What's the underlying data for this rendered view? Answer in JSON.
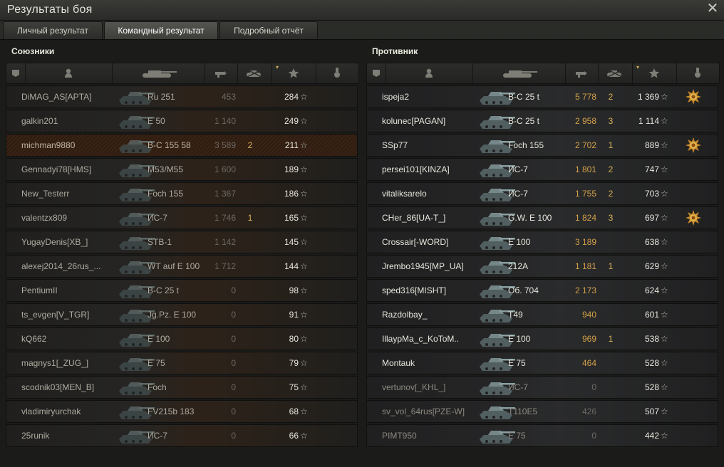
{
  "window": {
    "title": "Результаты боя"
  },
  "tabs": [
    {
      "label": "Личный результат",
      "active": false
    },
    {
      "label": "Командный результат",
      "active": true
    },
    {
      "label": "Подробный отчёт",
      "active": false
    }
  ],
  "allies": {
    "title": "Союзники",
    "rows": [
      {
        "player": "DiMAG_AS[APTA]",
        "tank": "Ru 251",
        "damage": "453",
        "kills": "",
        "xp": "284",
        "medal": false,
        "alive": false,
        "highlight": false
      },
      {
        "player": "galkin201",
        "tank": "E 50",
        "damage": "1 140",
        "kills": "",
        "xp": "249",
        "medal": false,
        "alive": false,
        "highlight": false
      },
      {
        "player": "michman9880",
        "tank": "B-C 155 58",
        "damage": "3 589",
        "kills": "2",
        "xp": "211",
        "medal": false,
        "alive": false,
        "highlight": true
      },
      {
        "player": "Gennadyi78[HMS]",
        "tank": "M53/M55",
        "damage": "1 600",
        "kills": "",
        "xp": "189",
        "medal": false,
        "alive": false,
        "highlight": false
      },
      {
        "player": "New_Testerr",
        "tank": "Foch 155",
        "damage": "1 367",
        "kills": "",
        "xp": "186",
        "medal": false,
        "alive": false,
        "highlight": false
      },
      {
        "player": "valentzx809",
        "tank": "ИС-7",
        "damage": "1 746",
        "kills": "1",
        "xp": "165",
        "medal": false,
        "alive": false,
        "highlight": false
      },
      {
        "player": "YugayDenis[XB_]",
        "tank": "STB-1",
        "damage": "1 142",
        "kills": "",
        "xp": "145",
        "medal": false,
        "alive": false,
        "highlight": false
      },
      {
        "player": "alexej2014_26rus_...",
        "tank": "WT auf E 100",
        "damage": "1 712",
        "kills": "",
        "xp": "144",
        "medal": false,
        "alive": false,
        "highlight": false
      },
      {
        "player": "PentiumII",
        "tank": "B-C 25 t",
        "damage": "0",
        "kills": "",
        "xp": "98",
        "medal": false,
        "alive": false,
        "highlight": false
      },
      {
        "player": "ts_evgen[V_TGR]",
        "tank": "Jg.Pz. E 100",
        "damage": "0",
        "kills": "",
        "xp": "91",
        "medal": false,
        "alive": false,
        "highlight": false
      },
      {
        "player": "kQ662",
        "tank": "E 100",
        "damage": "0",
        "kills": "",
        "xp": "80",
        "medal": false,
        "alive": false,
        "highlight": false
      },
      {
        "player": "magnys1[_ZUG_]",
        "tank": "E 75",
        "damage": "0",
        "kills": "",
        "xp": "79",
        "medal": false,
        "alive": false,
        "highlight": false
      },
      {
        "player": "scodnik03[MEN_B]",
        "tank": "Foch",
        "damage": "0",
        "kills": "",
        "xp": "75",
        "medal": false,
        "alive": false,
        "highlight": false
      },
      {
        "player": "vladimiryurchak",
        "tank": "FV215b 183",
        "damage": "0",
        "kills": "",
        "xp": "68",
        "medal": false,
        "alive": false,
        "highlight": false
      },
      {
        "player": "25runik",
        "tank": "ИС-7",
        "damage": "0",
        "kills": "",
        "xp": "66",
        "medal": false,
        "alive": false,
        "highlight": false
      }
    ]
  },
  "enemies": {
    "title": "Противник",
    "rows": [
      {
        "player": "ispeja2",
        "tank": "B-C 25 t",
        "damage": "5 778",
        "kills": "2",
        "xp": "1 369",
        "medal": true,
        "alive": true
      },
      {
        "player": "kolunec[PAGAN]",
        "tank": "B-C 25 t",
        "damage": "2 958",
        "kills": "3",
        "xp": "1 114",
        "medal": false,
        "alive": true
      },
      {
        "player": "SSp77",
        "tank": "Foch 155",
        "damage": "2 702",
        "kills": "1",
        "xp": "889",
        "medal": true,
        "alive": true
      },
      {
        "player": "persei101[KINZA]",
        "tank": "ИС-7",
        "damage": "1 801",
        "kills": "2",
        "xp": "747",
        "medal": false,
        "alive": true
      },
      {
        "player": "vitaliksarelo",
        "tank": "ИС-7",
        "damage": "1 755",
        "kills": "2",
        "xp": "703",
        "medal": false,
        "alive": true
      },
      {
        "player": "CHer_86[UA-T_]",
        "tank": "G.W. E 100",
        "damage": "1 824",
        "kills": "3",
        "xp": "697",
        "medal": true,
        "alive": true
      },
      {
        "player": "Crossair[-WORD]",
        "tank": "E 100",
        "damage": "3 189",
        "kills": "",
        "xp": "638",
        "medal": false,
        "alive": true
      },
      {
        "player": "Jrembo1945[MP_UA]",
        "tank": "212A",
        "damage": "1 181",
        "kills": "1",
        "xp": "629",
        "medal": false,
        "alive": true
      },
      {
        "player": "sped316[MISHT]",
        "tank": "Об. 704",
        "damage": "2 173",
        "kills": "",
        "xp": "624",
        "medal": false,
        "alive": true
      },
      {
        "player": "Razdolbay_",
        "tank": "T49",
        "damage": "940",
        "kills": "",
        "xp": "601",
        "medal": false,
        "alive": true
      },
      {
        "player": "IllaypMa_c_KoToM..",
        "tank": "E 100",
        "damage": "969",
        "kills": "1",
        "xp": "538",
        "medal": false,
        "alive": true
      },
      {
        "player": "Montauk",
        "tank": "E 75",
        "damage": "464",
        "kills": "",
        "xp": "528",
        "medal": false,
        "alive": true
      },
      {
        "player": "vertunov[_KHL_]",
        "tank": "ИС-7",
        "damage": "0",
        "kills": "",
        "xp": "528",
        "medal": false,
        "alive": false
      },
      {
        "player": "sv_vol_64rus[PZE-W]",
        "tank": "T110E5",
        "damage": "426",
        "kills": "",
        "xp": "507",
        "medal": false,
        "alive": false
      },
      {
        "player": "PIMT950",
        "tank": "E 75",
        "damage": "0",
        "kills": "",
        "xp": "442",
        "medal": false,
        "alive": false
      }
    ]
  },
  "icons": {
    "close": "close-icon",
    "columns": [
      "platoon-icon",
      "player-icon",
      "tank-icon",
      "damage-icon",
      "kills-icon",
      "xp-star-icon",
      "medal-icon"
    ]
  },
  "colors": {
    "damage_alive": "#d3a04a",
    "kills": "#d9b35c",
    "text_alive": "#e6e6dc",
    "text_dead": "#8d8a80",
    "highlight": "#3a2314"
  }
}
